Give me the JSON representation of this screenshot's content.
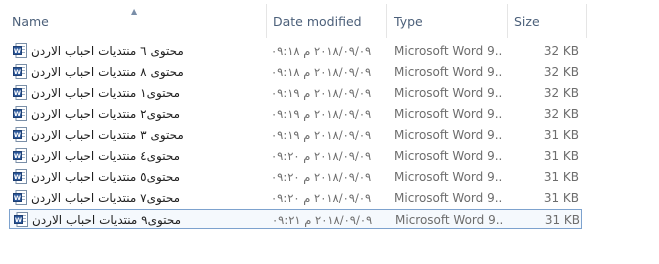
{
  "columns": {
    "name": "Name",
    "date": "Date modified",
    "type": "Type",
    "size": "Size"
  },
  "files": [
    {
      "name": "محتوى ٦ منتديات احباب الاردن",
      "date": "٢٠١٨/٠٩/٠٩ م ٠٩:١٨",
      "type": "Microsoft Word 9...",
      "size": "32 KB"
    },
    {
      "name": "محتوى ٨ منتديات احباب الاردن",
      "date": "٢٠١٨/٠٩/٠٩ م ٠٩:١٨",
      "type": "Microsoft Word 9...",
      "size": "32 KB"
    },
    {
      "name": "محتوى١ منتديات احباب الاردن",
      "date": "٢٠١٨/٠٩/٠٩ م ٠٩:١٩",
      "type": "Microsoft Word 9...",
      "size": "32 KB"
    },
    {
      "name": "محتوى٢ منتديات احباب الاردن",
      "date": "٢٠١٨/٠٩/٠٩ م ٠٩:١٩",
      "type": "Microsoft Word 9...",
      "size": "32 KB"
    },
    {
      "name": "محتوى ٣ منتديات احباب الاردن",
      "date": "٢٠١٨/٠٩/٠٩ م ٠٩:١٩",
      "type": "Microsoft Word 9...",
      "size": "31 KB"
    },
    {
      "name": "محتوى٤ منتديات احباب الاردن",
      "date": "٢٠١٨/٠٩/٠٩ م ٠٩:٢٠",
      "type": "Microsoft Word 9...",
      "size": "31 KB"
    },
    {
      "name": "محتوى٥ منتديات احباب الاردن",
      "date": "٢٠١٨/٠٩/٠٩ م ٠٩:٢٠",
      "type": "Microsoft Word 9...",
      "size": "31 KB"
    },
    {
      "name": "محتوى٧ منتديات احباب الاردن",
      "date": "٢٠١٨/٠٩/٠٩ م ٠٩:٢٠",
      "type": "Microsoft Word 9...",
      "size": "31 KB"
    },
    {
      "name": "محتوى٩ منتديات احباب الاردن",
      "date": "٢٠١٨/٠٩/٠٩ م ٠٩:٢١",
      "type": "Microsoft Word 9...",
      "size": "31 KB",
      "selected": true
    }
  ],
  "icons": {
    "file_icon": "word-document-icon",
    "sort_icon": "sort-ascending-icon"
  },
  "colors": {
    "selection_border": "#7da2ce",
    "header_text": "#4c607a",
    "word_blue": "#2b579a"
  }
}
